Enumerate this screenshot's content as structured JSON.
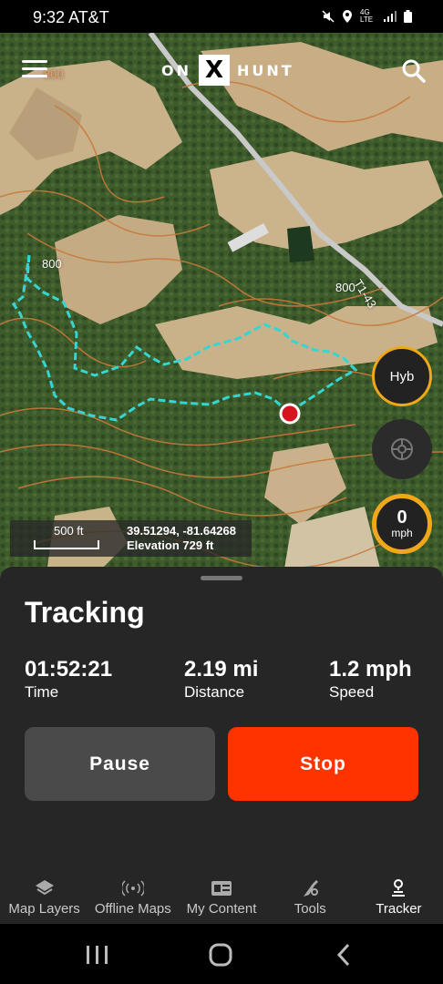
{
  "status": {
    "time_carrier": "9:32 AT&T",
    "network": "4G LTE"
  },
  "app": {
    "logo_left": "ON",
    "logo_mark": "X",
    "logo_right": "HUNT"
  },
  "map": {
    "contour_labels": [
      "800",
      "800",
      "800"
    ],
    "road_label": "T1-43",
    "layer_button": "Hyb",
    "speed_value": "0",
    "speed_unit": "mph",
    "scale_label": "500 ft",
    "coordinates": "39.51294, -81.64268",
    "elevation": "Elevation 729 ft",
    "track_color": "#35d6d2",
    "accent_color": "#f0a81a"
  },
  "tracker": {
    "title": "Tracking",
    "time_value": "01:52:21",
    "time_label": "Time",
    "distance_value": "2.19 mi",
    "distance_label": "Distance",
    "speed_value": "1.2 mph",
    "speed_label": "Speed",
    "pause_label": "Pause",
    "stop_label": "Stop",
    "stop_color": "#ff3300"
  },
  "nav": {
    "items": [
      {
        "label": "Map Layers",
        "icon": "layers-icon"
      },
      {
        "label": "Offline Maps",
        "icon": "offline-icon"
      },
      {
        "label": "My Content",
        "icon": "content-icon"
      },
      {
        "label": "Tools",
        "icon": "tools-icon"
      },
      {
        "label": "Tracker",
        "icon": "tracker-icon"
      }
    ],
    "active": "Tracker"
  }
}
